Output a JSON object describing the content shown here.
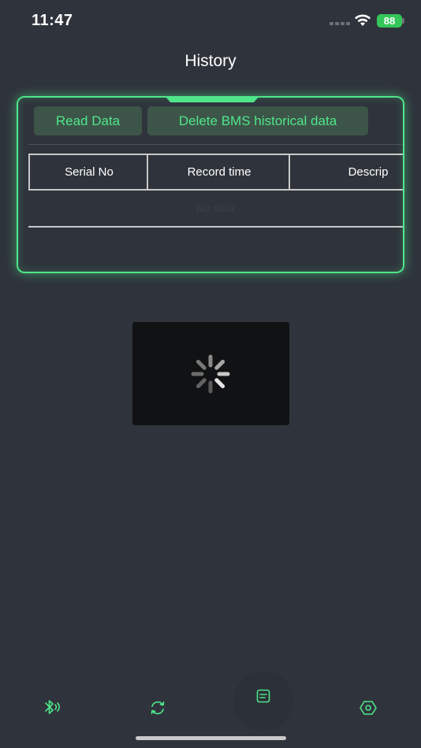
{
  "status_bar": {
    "time": "11:47",
    "battery": "88"
  },
  "header": {
    "title": "History"
  },
  "panel": {
    "read_button_label": "Read Data",
    "delete_button_label": "Delete BMS historical data",
    "table": {
      "columns": [
        "Serial No",
        "Record time",
        "Descrip"
      ],
      "empty_text": "No data"
    }
  },
  "loading": {
    "visible": true
  },
  "tab_bar": {
    "items": [
      {
        "icon": "bluetooth-icon",
        "active": false
      },
      {
        "icon": "sync-icon",
        "active": false
      },
      {
        "icon": "history-icon",
        "active": true
      },
      {
        "icon": "settings-icon",
        "active": false
      }
    ]
  },
  "colors": {
    "background": "#2f343c",
    "accent": "#4fe68a",
    "button_bg": "#3d5549",
    "loading_bg": "#111214",
    "battery": "#34c759"
  }
}
